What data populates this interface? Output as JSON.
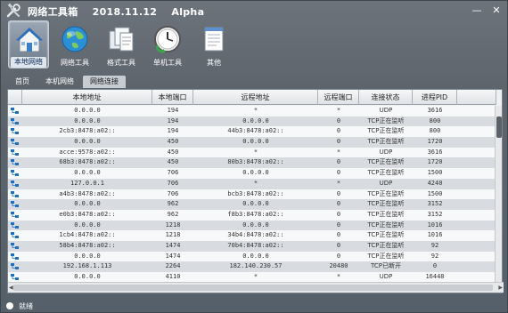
{
  "title": {
    "app": "网络工具箱",
    "date": "2018.11.12",
    "edition": "Alpha"
  },
  "window_buttons": {
    "minimize": "—",
    "close": "✕"
  },
  "toolbar": [
    {
      "label": "本地网络",
      "icon": "house-icon"
    },
    {
      "label": "网络工具",
      "icon": "globe-icon"
    },
    {
      "label": "格式工具",
      "icon": "documents-icon"
    },
    {
      "label": "单机工具",
      "icon": "clock-icon"
    },
    {
      "label": "其他",
      "icon": "notepad-icon"
    }
  ],
  "tabs": [
    "首页",
    "本机网络",
    "网络连接"
  ],
  "table": {
    "columns": [
      "",
      "本地地址",
      "本地端口",
      "远程地址",
      "远程端口",
      "连接状态",
      "进程PID"
    ],
    "rows": [
      [
        "0.0.0.0",
        "194",
        "*",
        "*",
        "UDP",
        "3616"
      ],
      [
        "0.0.0.0",
        "194",
        "0.0.0.0",
        "0",
        "TCP正在监听",
        "800"
      ],
      [
        "2cb3:8478:a02::",
        "194",
        "44b3:8478:a02::",
        "0",
        "TCP正在监听",
        "800"
      ],
      [
        "0.0.0.0",
        "450",
        "0.0.0.0",
        "0",
        "TCP正在监听",
        "1720"
      ],
      [
        "acce:9578:a02::",
        "450",
        "*",
        "*",
        "UDP",
        "3616"
      ],
      [
        "68b3:8478:a02::",
        "450",
        "80b3:8478:a02::",
        "0",
        "TCP正在监听",
        "1720"
      ],
      [
        "0.0.0.0",
        "706",
        "0.0.0.0",
        "0",
        "TCP正在监听",
        "1500"
      ],
      [
        "127.0.0.1",
        "706",
        "*",
        "*",
        "UDP",
        "4240"
      ],
      [
        "a4b3:8478:a02::",
        "706",
        "bcb3:8478:a02::",
        "0",
        "TCP正在监听",
        "1500"
      ],
      [
        "0.0.0.0",
        "962",
        "0.0.0.0",
        "0",
        "TCP正在监听",
        "3152"
      ],
      [
        "e0b3:8478:a02::",
        "962",
        "f8b3:8478:a02::",
        "0",
        "TCP正在监听",
        "3152"
      ],
      [
        "0.0.0.0",
        "1218",
        "0.0.0.0",
        "0",
        "TCP正在监听",
        "1016"
      ],
      [
        "1cb4:8478:a02::",
        "1218",
        "34b4:8478:a02::",
        "0",
        "TCP正在监听",
        "1016"
      ],
      [
        "58b4:8478:a02::",
        "1474",
        "70b4:8478:a02::",
        "0",
        "TCP正在监听",
        "92"
      ],
      [
        "0.0.0.0",
        "1474",
        "0.0.0.0",
        "0",
        "TCP正在监听",
        "92"
      ],
      [
        "192.168.1.113",
        "2264",
        "182.140.230.57",
        "20480",
        "TCP已断开",
        "0"
      ],
      [
        "0.0.0.0",
        "4110",
        "*",
        "*",
        "UDP",
        "16448"
      ]
    ]
  },
  "status": {
    "text": "就绪"
  },
  "colors": {
    "accent": "#0b2a5a",
    "window_bg": "#5d646c",
    "row_alt": "#d8dce1"
  }
}
